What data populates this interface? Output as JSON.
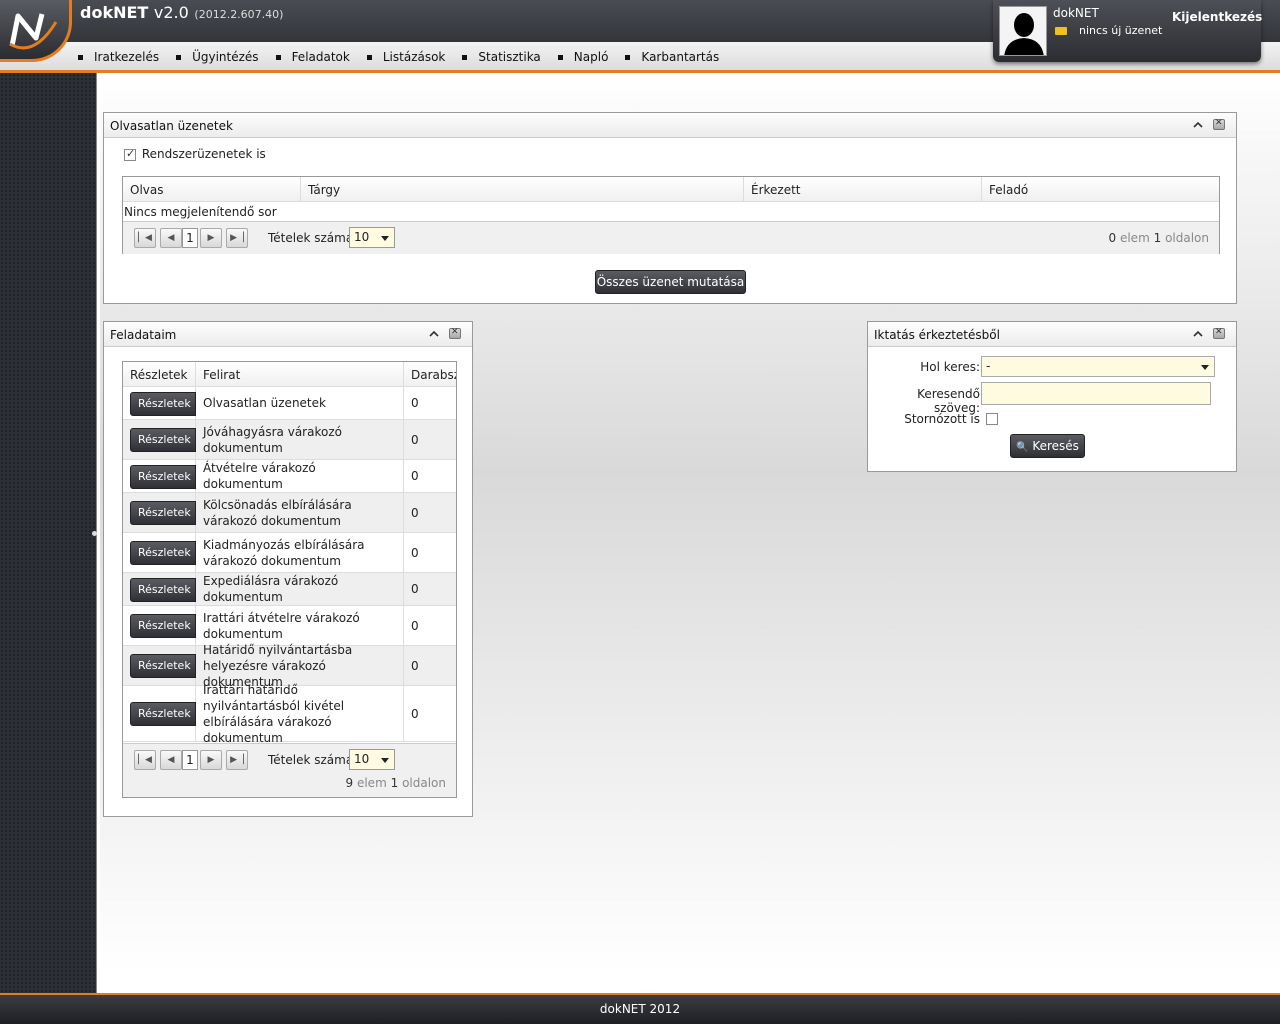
{
  "app": {
    "name": "dokNET",
    "version": "v2.0",
    "build": "(2012.2.607.40)"
  },
  "nav": [
    "Iratkezelés",
    "Ügyintézés",
    "Feladatok",
    "Listázások",
    "Statisztika",
    "Napló",
    "Karbantartás"
  ],
  "user": {
    "name": "dokNET",
    "messages": "nincs új üzenet",
    "logout": "Kijelentkezés"
  },
  "unread": {
    "title": "Olvasatlan üzenetek",
    "system_checkbox_label": "Rendszerüzenetek is",
    "system_checked": true,
    "columns": [
      "Olvas",
      "Tárgy",
      "Érkezett",
      "Feladó"
    ],
    "empty_text": "Nincs megjelenítendő sor",
    "page": "1",
    "items_label": "Tételek száma:",
    "page_size": "10",
    "info_count": "0",
    "info_elem": "elem",
    "info_pages": "1",
    "info_oldalon": "oldalon",
    "show_all": "Összes üzenet mutatása"
  },
  "tasks": {
    "title": "Feladataim",
    "columns": [
      "Részletek",
      "Felirat",
      "Darabszám"
    ],
    "button_label": "Részletek",
    "rows": [
      {
        "label": "Olvasatlan üzenetek",
        "count": "0"
      },
      {
        "label": "Jóváhagyásra várakozó dokumentum",
        "count": "0"
      },
      {
        "label": "Átvételre várakozó dokumentum",
        "count": "0"
      },
      {
        "label": "Kölcsönadás elbírálására várakozó dokumentum",
        "count": "0"
      },
      {
        "label": "Kiadmányozás elbírálására várakozó dokumentum",
        "count": "0"
      },
      {
        "label": "Expediálásra várakozó dokumentum",
        "count": "0"
      },
      {
        "label": "Irattári átvételre várakozó dokumentum",
        "count": "0"
      },
      {
        "label": "Határidő nyilvántartásba helyezésre várakozó dokumentum",
        "count": "0"
      },
      {
        "label": "Irattári határidő nyilvántartásból kivétel elbírálására várakozó dokumentum",
        "count": "0"
      }
    ],
    "page": "1",
    "items_label": "Tételek száma:",
    "page_size": "10",
    "info_count": "9",
    "info_elem": "elem",
    "info_pages": "1",
    "info_oldalon": "oldalon"
  },
  "search": {
    "title": "Iktatás érkeztetésből",
    "where_label": "Hol keres:",
    "where_value": "-",
    "text_label": "Keresendő szöveg:",
    "text_value": "",
    "storno_label": "Stornózott is",
    "storno_checked": false,
    "button": "Keresés"
  },
  "footer": "dokNET 2012",
  "colors": {
    "accent": "#e47d1f",
    "dark": "#34363c"
  }
}
